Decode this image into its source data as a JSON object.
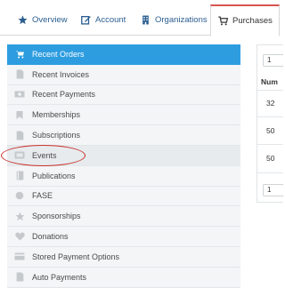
{
  "tabs": [
    {
      "label": "Overview",
      "icon": "star-icon"
    },
    {
      "label": "Account",
      "icon": "edit-icon"
    },
    {
      "label": "Organizations",
      "icon": "building-icon"
    },
    {
      "label": "Purchases",
      "icon": "cart-icon"
    }
  ],
  "sidebar": {
    "items": [
      {
        "label": "Recent Orders",
        "icon": "cart-icon"
      },
      {
        "label": "Recent Invoices",
        "icon": "document-icon"
      },
      {
        "label": "Recent Payments",
        "icon": "cash-icon"
      },
      {
        "label": "Memberships",
        "icon": "bookmark-icon"
      },
      {
        "label": "Subscriptions",
        "icon": "document-icon"
      },
      {
        "label": "Events",
        "icon": "ticket-icon"
      },
      {
        "label": "Publications",
        "icon": "book-icon"
      },
      {
        "label": "FASE",
        "icon": "circle-icon"
      },
      {
        "label": "Sponsorships",
        "icon": "star-icon"
      },
      {
        "label": "Donations",
        "icon": "heart-icon"
      },
      {
        "label": "Stored Payment Options",
        "icon": "card-icon"
      },
      {
        "label": "Auto Payments",
        "icon": "document-icon"
      }
    ]
  },
  "panel": {
    "page_size_top": "1",
    "header": "Num",
    "rows": [
      "32",
      "50",
      "50"
    ],
    "page_size_bottom": "1"
  },
  "colors": {
    "active": "#2d9de0",
    "tab_accent": "#d9534f",
    "highlight_circle": "#c9302c"
  }
}
